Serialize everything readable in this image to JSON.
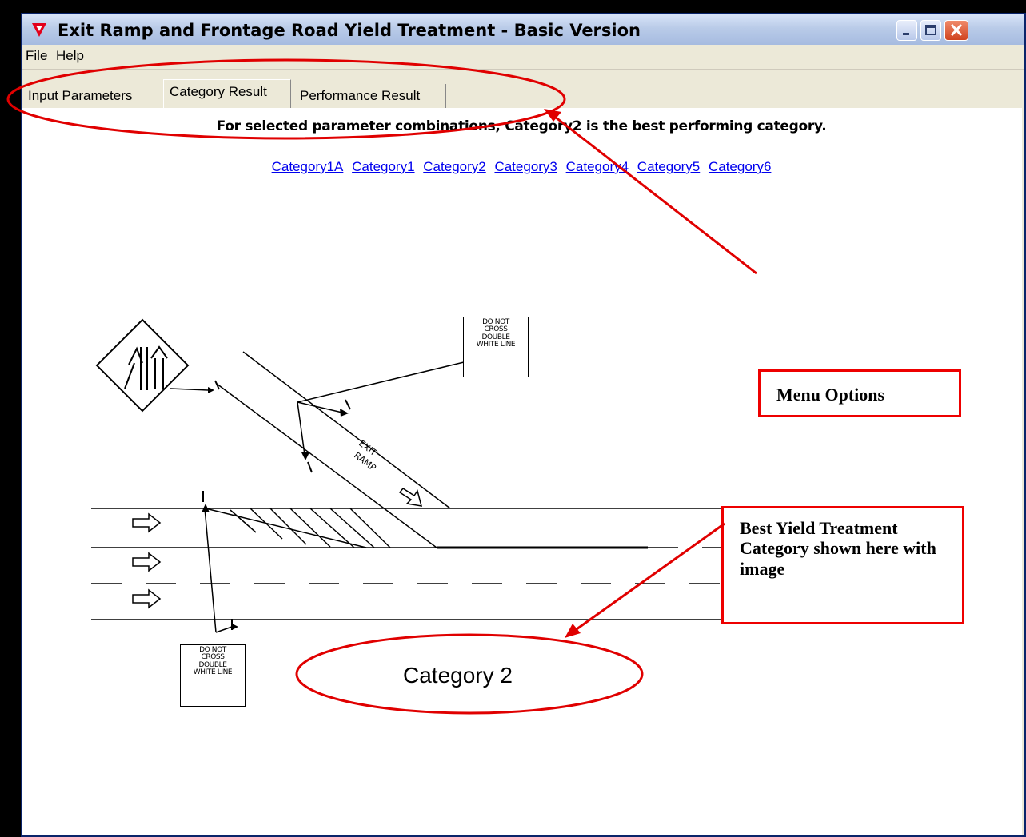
{
  "window": {
    "title": "Exit Ramp and Frontage Road Yield Treatment - Basic Version"
  },
  "menu": {
    "items": [
      "File",
      "Help"
    ]
  },
  "tabs": [
    {
      "label": "Input Parameters",
      "selected": false
    },
    {
      "label": "Category Result",
      "selected": true
    },
    {
      "label": "Performance Result",
      "selected": false
    }
  ],
  "content": {
    "headline": "For selected parameter combinations, Category2 is the best performing category.",
    "category_links": [
      "Category1A",
      "Category1",
      "Category2",
      "Category3",
      "Category4",
      "Category5",
      "Category6"
    ],
    "diagram": {
      "ramp_text_1": "EXIT",
      "ramp_text_2": "RAMP",
      "sign_top": [
        "DO NOT",
        "CROSS",
        "DOUBLE",
        "WHITE LINE"
      ],
      "sign_bottom": [
        "DO NOT",
        "CROSS",
        "DOUBLE",
        "WHITE LINE"
      ],
      "category_label": "Category 2"
    }
  },
  "annotations": {
    "menu_options": "Menu Options",
    "best_yield": "Best Yield Treatment Category shown here with image"
  },
  "colors": {
    "annotation_red": "#e00000",
    "link_blue": "#0000ee",
    "titlebar": "#b9cbe8"
  }
}
